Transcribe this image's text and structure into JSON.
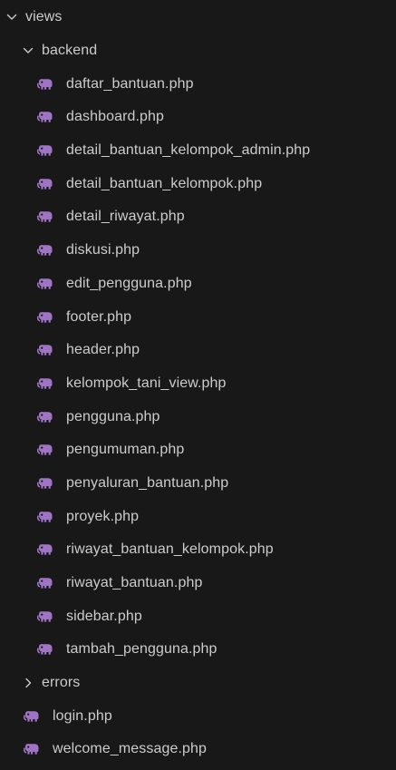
{
  "colors": {
    "background": "#181818",
    "text": "#cccccc",
    "php_icon": "#a074c4"
  },
  "explorer": {
    "folders": {
      "views": {
        "label": "views",
        "icon": "chevron-down-icon"
      },
      "backend": {
        "label": "backend",
        "icon": "chevron-down-icon"
      },
      "errors": {
        "label": "errors",
        "icon": "chevron-right-icon"
      }
    },
    "backend_files": [
      {
        "label": "daftar_bantuan.php",
        "icon": "php-elephant-icon"
      },
      {
        "label": "dashboard.php",
        "icon": "php-elephant-icon"
      },
      {
        "label": "detail_bantuan_kelompok_admin.php",
        "icon": "php-elephant-icon"
      },
      {
        "label": "detail_bantuan_kelompok.php",
        "icon": "php-elephant-icon"
      },
      {
        "label": "detail_riwayat.php",
        "icon": "php-elephant-icon"
      },
      {
        "label": "diskusi.php",
        "icon": "php-elephant-icon"
      },
      {
        "label": "edit_pengguna.php",
        "icon": "php-elephant-icon"
      },
      {
        "label": "footer.php",
        "icon": "php-elephant-icon"
      },
      {
        "label": "header.php",
        "icon": "php-elephant-icon"
      },
      {
        "label": "kelompok_tani_view.php",
        "icon": "php-elephant-icon"
      },
      {
        "label": "pengguna.php",
        "icon": "php-elephant-icon"
      },
      {
        "label": "pengumuman.php",
        "icon": "php-elephant-icon"
      },
      {
        "label": "penyaluran_bantuan.php",
        "icon": "php-elephant-icon"
      },
      {
        "label": "proyek.php",
        "icon": "php-elephant-icon"
      },
      {
        "label": "riwayat_bantuan_kelompok.php",
        "icon": "php-elephant-icon"
      },
      {
        "label": "riwayat_bantuan.php",
        "icon": "php-elephant-icon"
      },
      {
        "label": "sidebar.php",
        "icon": "php-elephant-icon"
      },
      {
        "label": "tambah_pengguna.php",
        "icon": "php-elephant-icon"
      }
    ],
    "views_files": [
      {
        "label": "login.php",
        "icon": "php-elephant-icon"
      },
      {
        "label": "welcome_message.php",
        "icon": "php-elephant-icon"
      }
    ]
  }
}
